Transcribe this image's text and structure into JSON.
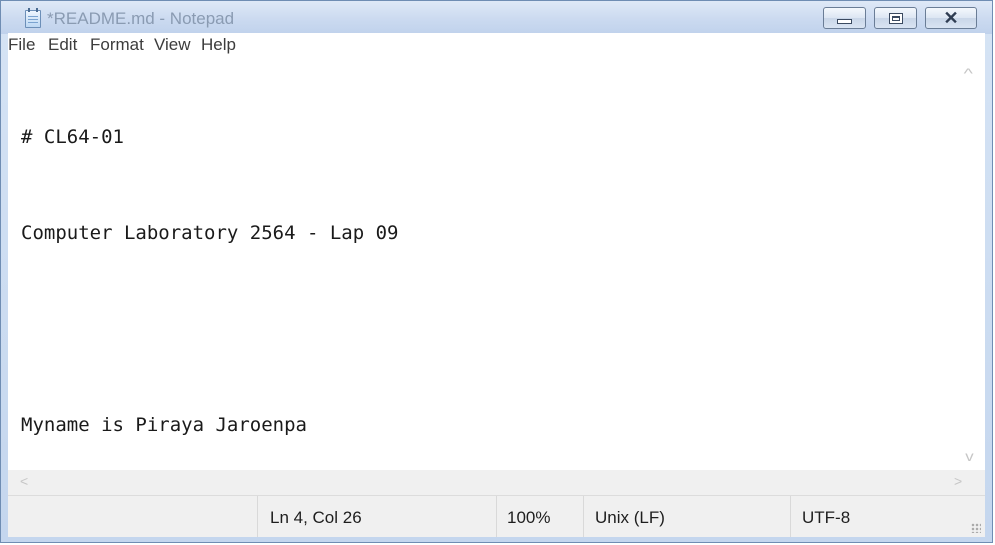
{
  "window": {
    "title": "*README.md - Notepad",
    "controls": {
      "minimize": "minimize",
      "maximize": "maximize",
      "close": "✕"
    }
  },
  "menu": {
    "items": [
      "File",
      "Edit",
      "Format",
      "View",
      "Help"
    ]
  },
  "document": {
    "lines": [
      "# CL64-01",
      "Computer Laboratory 2564 - Lap 09",
      "",
      "Myname is Piraya Jaroenpa"
    ]
  },
  "scrollbars": {
    "up_arrow": "^",
    "down_arrow": "v",
    "left_arrow": "<",
    "right_arrow": ">"
  },
  "statusbar": {
    "position": "Ln 4, Col 26",
    "zoom": "100%",
    "line_ending": "Unix (LF)",
    "encoding": "UTF-8"
  },
  "icons": {
    "app": "notepad-icon",
    "resize": "resize-grip-icon"
  },
  "colors": {
    "title_inactive_text": "#8a9bb2",
    "frame": "#c4d6ee",
    "editor_bg": "#ffffff",
    "status_bg": "#f0f0f0"
  }
}
